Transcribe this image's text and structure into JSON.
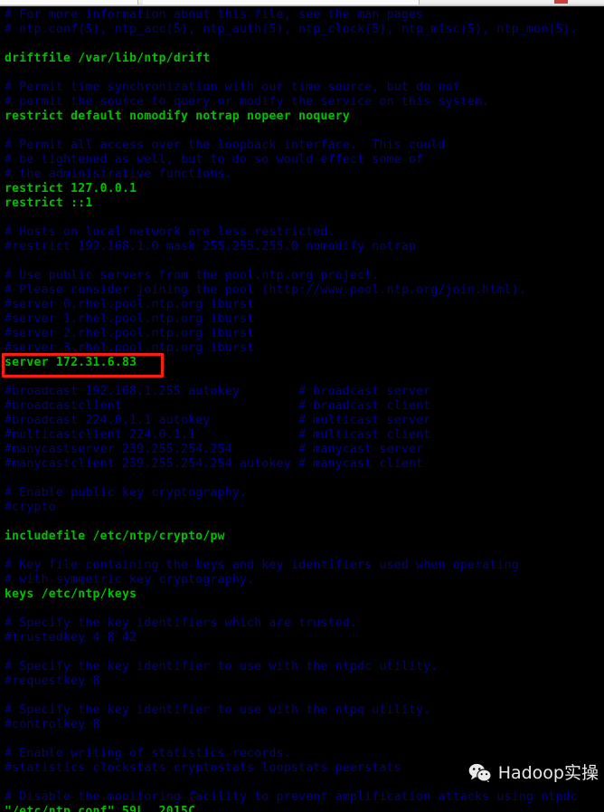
{
  "window": {
    "chrome_visible": true,
    "chrome_bg": "#eceaea",
    "close_button_color": "#c9403c"
  },
  "terminal": {
    "background": "#000000",
    "comment_color": "#00008f",
    "code_color": "#00c300",
    "editor": "vim",
    "file_name": "/etc/ntp.conf",
    "lines": [
      {
        "text": "# For more information about this file, see the man pages",
        "style": "comment"
      },
      {
        "text": "# ntp.conf(5), ntp_acc(5), ntp_auth(5), ntp_clock(5), ntp_misc(5), ntp_mon(5).",
        "style": "comment"
      },
      {
        "text": "",
        "style": "blank"
      },
      {
        "text": "driftfile /var/lib/ntp/drift",
        "style": "code"
      },
      {
        "text": "",
        "style": "blank"
      },
      {
        "text": "# Permit time synchronization with our time source, but do not",
        "style": "comment"
      },
      {
        "text": "# permit the source to query or modify the service on this system.",
        "style": "comment"
      },
      {
        "text": "restrict default nomodify notrap nopeer noquery",
        "style": "code"
      },
      {
        "text": "",
        "style": "blank"
      },
      {
        "text": "# Permit all access over the loopback interface.  This could",
        "style": "comment"
      },
      {
        "text": "# be tightened as well, but to do so would effect some of",
        "style": "comment"
      },
      {
        "text": "# the administrative functions.",
        "style": "comment"
      },
      {
        "text": "restrict 127.0.0.1",
        "style": "code"
      },
      {
        "text": "restrict ::1",
        "style": "code"
      },
      {
        "text": "",
        "style": "blank"
      },
      {
        "text": "# Hosts on local network are less restricted.",
        "style": "comment"
      },
      {
        "text": "#restrict 192.168.1.0 mask 255.255.255.0 nomodify notrap",
        "style": "comment"
      },
      {
        "text": "",
        "style": "blank"
      },
      {
        "text": "# Use public servers from the pool.ntp.org project.",
        "style": "comment"
      },
      {
        "text": "# Please consider joining the pool (http://www.pool.ntp.org/join.html).",
        "style": "comment"
      },
      {
        "text": "#server 0.rhel.pool.ntp.org iburst",
        "style": "comment"
      },
      {
        "text": "#server 1.rhel.pool.ntp.org iburst",
        "style": "comment"
      },
      {
        "text": "#server 2.rhel.pool.ntp.org iburst",
        "style": "comment"
      },
      {
        "text": "#server 3.rhel.pool.ntp.org iburst",
        "style": "comment"
      },
      {
        "text": "server 172.31.6.83",
        "style": "code"
      },
      {
        "text": "",
        "style": "blank"
      },
      {
        "text": "#broadcast 192.168.1.255 autokey        # broadcast server",
        "style": "comment"
      },
      {
        "text": "#broadcastclient                        # broadcast client",
        "style": "comment"
      },
      {
        "text": "#broadcast 224.0.1.1 autokey            # multicast server",
        "style": "comment"
      },
      {
        "text": "#multicastclient 224.0.1.1              # multicast client",
        "style": "comment"
      },
      {
        "text": "#manycastserver 239.255.254.254         # manycast server",
        "style": "comment"
      },
      {
        "text": "#manycastclient 239.255.254.254 autokey # manycast client",
        "style": "comment"
      },
      {
        "text": "",
        "style": "blank"
      },
      {
        "text": "# Enable public key cryptography.",
        "style": "comment"
      },
      {
        "text": "#crypto",
        "style": "comment"
      },
      {
        "text": "",
        "style": "blank"
      },
      {
        "text": "includefile /etc/ntp/crypto/pw",
        "style": "code"
      },
      {
        "text": "",
        "style": "blank"
      },
      {
        "text": "# Key file containing the keys and key identifiers used when operating",
        "style": "comment"
      },
      {
        "text": "# with symmetric key cryptography.",
        "style": "comment"
      },
      {
        "text": "keys /etc/ntp/keys",
        "style": "code"
      },
      {
        "text": "",
        "style": "blank"
      },
      {
        "text": "# Specify the key identifiers which are trusted.",
        "style": "comment"
      },
      {
        "text": "#trustedkey 4 8 42",
        "style": "comment"
      },
      {
        "text": "",
        "style": "blank"
      },
      {
        "text": "# Specify the key identifier to use with the ntpdc utility.",
        "style": "comment"
      },
      {
        "text": "#requestkey 8",
        "style": "comment"
      },
      {
        "text": "",
        "style": "blank"
      },
      {
        "text": "# Specify the key identifier to use with the ntpq utility.",
        "style": "comment"
      },
      {
        "text": "#controlkey 8",
        "style": "comment"
      },
      {
        "text": "",
        "style": "blank"
      },
      {
        "text": "# Enable writing of statistics records.",
        "style": "comment"
      },
      {
        "text": "#statistics clockstats cryptostats loopstats peerstats",
        "style": "comment"
      },
      {
        "text": "",
        "style": "blank"
      },
      {
        "text": "# Disable the monitoring facility to prevent amplification attacks using ntpdc",
        "style": "comment"
      },
      {
        "text": "\"/etc/ntp.conf\" 59L, 2015C",
        "style": "status"
      }
    ]
  },
  "annotation": {
    "highlight_box_color": "#ff1a12",
    "highlighted_line": "server 172.31.6.83"
  },
  "watermark": {
    "label": "Hadoop实操",
    "icon": "wechat-icon",
    "color": "#f2f2f2"
  }
}
